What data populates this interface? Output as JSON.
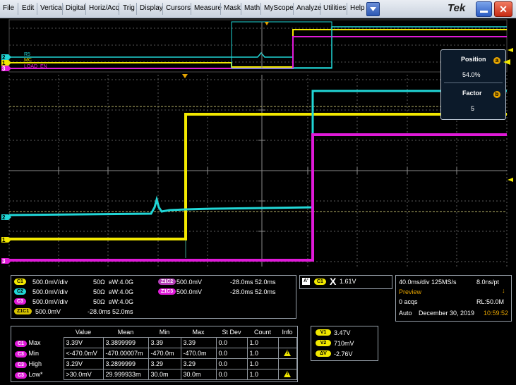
{
  "menu": {
    "items": [
      "File",
      "Edit",
      "Vertical",
      "Digital",
      "Horiz/Acq",
      "Trig",
      "Display",
      "Cursors",
      "Measure",
      "Mask",
      "Math",
      "MyScope",
      "Analyze",
      "Utilities",
      "Help"
    ],
    "brand": "Tek"
  },
  "colors": {
    "ch1": "#f2e800",
    "ch2": "#21d6d6",
    "ch3": "#e01ad8",
    "grid": "#6c6c6c",
    "accent_orange": "#e6a400"
  },
  "overview": {
    "labels": [
      "R5",
      "MC",
      "LOAD_EN"
    ]
  },
  "position_panel": {
    "position_label": "Position",
    "position_value": "54.0%",
    "position_knob": "a",
    "factor_label": "Factor",
    "factor_value": "5",
    "factor_knob": "b"
  },
  "channel_markers": {
    "ch2": "2",
    "ch1": "1",
    "ch3": "3"
  },
  "channels_panel": {
    "rows": [
      {
        "badge": "C1",
        "scale": "500.0mV/div",
        "imp": "50Ω",
        "bw": "W:4.0G"
      },
      {
        "badge": "C2",
        "scale": "500.0mV/div",
        "imp": "50Ω",
        "bw": "W:4.0G"
      },
      {
        "badge": "C3",
        "scale": "500.0mV/div",
        "imp": "50Ω",
        "bw": "W:4.0G"
      }
    ],
    "zoom_rows": [
      {
        "badge": "Z1C2",
        "scale": "500.0mV",
        "range": "-28.0ms 52.0ms"
      },
      {
        "badge": "Z1C3",
        "scale": "500.0mV",
        "range": "-28.0ms 52.0ms"
      }
    ],
    "z1c1": {
      "badge": "Z1C1",
      "scale": "500.0mV",
      "range": "-28.0ms 52.0ms"
    }
  },
  "trigger_panel": {
    "mode_badge": "A'",
    "source_badge": "C1",
    "slope_icon": "X",
    "level": "1.61V"
  },
  "acq_panel": {
    "timebase": "40.0ms/div 125MS/s",
    "pts": "8.0ns/pt",
    "mode": "Preview",
    "acqs": "0 acqs",
    "record": "RL:50.0M",
    "run": "Auto",
    "date": "December 30, 2019",
    "time": "10:59:52"
  },
  "measurements": {
    "headers": [
      "Value",
      "Mean",
      "Min",
      "Max",
      "St Dev",
      "Count",
      "Info"
    ],
    "rows": [
      {
        "badge": "C1",
        "name": "Max",
        "value": "3.39V",
        "mean": "3.3899999",
        "min": "3.39",
        "max": "3.39",
        "stdev": "0.0",
        "count": "1.0",
        "warn": false
      },
      {
        "badge": "C3",
        "name": "Min",
        "value": "<-470.0mV",
        "mean": "-470.00007m",
        "min": "-470.0m",
        "max": "-470.0m",
        "stdev": "0.0",
        "count": "1.0",
        "warn": true
      },
      {
        "badge": "C3",
        "name": "High",
        "value": "3.29V",
        "mean": "3.2899999",
        "min": "3.29",
        "max": "3.29",
        "stdev": "0.0",
        "count": "1.0",
        "warn": false
      },
      {
        "badge": "C3",
        "name": "Low*",
        "value": ">30.0mV",
        "mean": "29.999933m",
        "min": "30.0m",
        "max": "30.0m",
        "stdev": "0.0",
        "count": "1.0",
        "warn": true
      }
    ],
    "warn_glyph": "!"
  },
  "cursor_panel": {
    "rows": [
      {
        "badge": "V1",
        "value": "3.47V"
      },
      {
        "badge": "V2",
        "value": "710mV"
      },
      {
        "badge": "ΔV",
        "value": "-2.76V"
      }
    ]
  }
}
